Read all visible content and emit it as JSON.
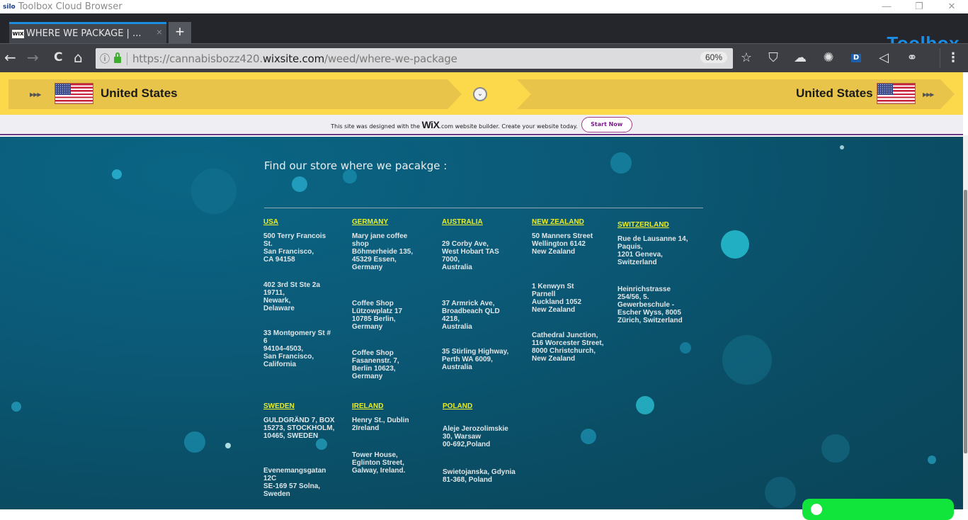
{
  "window": {
    "app_logo": "silo",
    "app_title": "Toolbox Cloud Browser",
    "controls": {
      "minimize": "—",
      "restore": "❐",
      "close": "✕"
    }
  },
  "browser": {
    "tab": {
      "favicon": "WIX",
      "title": "WHERE WE PACKAGE | ...",
      "close": "×"
    },
    "new_tab": "+",
    "brand": "Toolbox",
    "nav": {
      "back": "←",
      "forward": "→",
      "reload": "C",
      "home": "⌂"
    },
    "url": {
      "info": "ⓘ",
      "prefix": "https://cannabisbozz420.",
      "domain": "wixsite.com",
      "path": "/weed/where-we-package"
    },
    "zoom": "60%",
    "toolbar_icons": [
      "star-icon",
      "bookmark-icon",
      "cloud-download-icon",
      "bug-icon",
      "extension-dp-icon",
      "send-icon",
      "circles-icon",
      "menu-icon"
    ],
    "toolbar_glyphs": [
      "☆",
      "⛉",
      "☁",
      "✺",
      "D",
      "◁",
      "⚭",
      "⋮"
    ]
  },
  "language_bar": {
    "left_label": "United States",
    "right_label": "United States",
    "arrows": "▶▶▶",
    "toggle": "⌄"
  },
  "wix_banner": {
    "text_before": "This site was designed with the ",
    "logo": "WiX",
    "text_after": ".com website builder. Create your website today.",
    "button": "Start Now"
  },
  "main": {
    "headline": "Find our store where we pacakge :",
    "row1": [
      {
        "country": "USA",
        "addresses": [
          "500 Terry Francois\nSt.\nSan Francisco,\nCA 94158",
          "402 3rd St Ste 2a\n19711,\nNewark,\nDelaware",
          "33 Montgomery St #\n6\n94104-4503,\nSan Francisco,\nCalifornia"
        ]
      },
      {
        "country": "GERMANY",
        "addresses": [
          "Mary jane coffee\nshop\nBöhmerheide 135,\n45329 Essen,\nGermany",
          "Coffee Shop\nLützowplatz 17\n10785 Berlin,\nGermany",
          "Coffee Shop\nFasanenstr. 7,\nBerlin 10623,\nGermany"
        ]
      },
      {
        "country": "AUSTRALIA",
        "addresses": [
          "29 Corby Ave,\nWest Hobart TAS\n7000,\nAustralia",
          "37 Armrick Ave,\nBroadbeach QLD\n4218,\nAustralia",
          "35 Stirling Highway,\nPerth WA 6009,\nAustralia"
        ]
      },
      {
        "country": "NEW ZEALAND",
        "addresses": [
          "50 Manners Street\nWellington 6142\nNew Zealand",
          "1 Kenwyn St\nParnell\nAuckland 1052\nNew Zealand",
          "Cathedral Junction,\n116 Worcester Street,\n8000 Christchurch,\nNew Zealand"
        ]
      },
      {
        "country": "SWITZERLAND",
        "addresses": [
          "Rue de Lausanne 14,\nPaquis,\n1201 Geneva,\nSwitzerland",
          "Heinrichstrasse\n254/56, 5.\nGewerbeschule -\nEscher Wyss, 8005\nZürich, Switzerland"
        ]
      }
    ],
    "row2": [
      {
        "country": "SWEDEN",
        "addresses": [
          "GULDGRÄND 7, BOX\n15273, STOCKHOLM,\n10465, SWEDEN",
          "Evenemangsgatan\n12C\nSE-169 57 Solna,\nSweden"
        ]
      },
      {
        "country": "IRELAND",
        "addresses": [
          "Henry St., Dublin\n2Ireland",
          "Tower House,\nEglinton Street,\nGalway, Ireland."
        ]
      },
      {
        "country": "POLAND",
        "addresses": [
          "Aleje Jerozolimskie\n30, Warsaw\n00-692,Poland",
          "Swietojanska, Gdynia\n81-368, Poland"
        ]
      }
    ]
  },
  "colors": {
    "country_link": "#e8ee2a",
    "address_text": "#dfe6e8",
    "brand": "#1a8de6",
    "language_bar": "#fcd94a",
    "chat_button": "#11e43a"
  }
}
